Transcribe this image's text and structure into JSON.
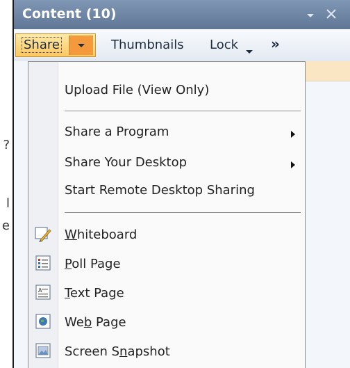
{
  "pane": {
    "title": "Content (10)"
  },
  "toolbar": {
    "share_label": "Share",
    "thumbnails_label": "Thumbnails",
    "lock_label": "Lock",
    "overflow_label": "»"
  },
  "menu": {
    "upload": "Upload File (View Only)",
    "share_program": "Share a Program",
    "share_desktop": "Share Your Desktop",
    "remote_sharing": "Start Remote Desktop Sharing",
    "whiteboard": {
      "pre": "",
      "key": "W",
      "post": "hiteboard"
    },
    "poll": {
      "pre": "",
      "key": "P",
      "post": "oll Page"
    },
    "text": {
      "pre": "",
      "key": "T",
      "post": "ext Page"
    },
    "web": {
      "pre": "We",
      "key": "b",
      "post": " Page"
    },
    "snapshot": {
      "pre": "Screen S",
      "key": "n",
      "post": "apshot"
    }
  },
  "background_fragments": [
    "?",
    "",
    "l",
    "e"
  ],
  "colors": {
    "titlebar": "#6f87a6",
    "share_active": "#ffc860",
    "menu_bg": "#fafafa"
  },
  "icons": {
    "title_dropdown": "chevron-down-icon",
    "title_close": "close-icon",
    "whiteboard": "whiteboard-icon",
    "poll": "poll-page-icon",
    "text": "text-page-icon",
    "web": "web-page-icon",
    "snapshot": "screen-snapshot-icon"
  }
}
